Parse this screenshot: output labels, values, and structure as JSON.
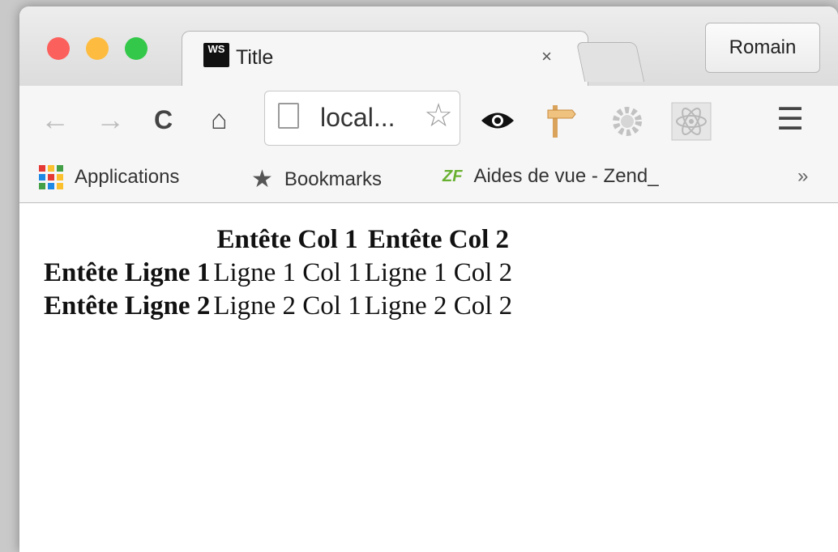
{
  "tab": {
    "favicon_text": "WS",
    "title": "Title",
    "close": "×"
  },
  "profile_button": "Romain",
  "toolbar": {
    "back": "←",
    "forward": "→",
    "reload": "C",
    "home": "⌂",
    "url": "local...",
    "star": "☆",
    "menu": "☰"
  },
  "bookmarks": [
    {
      "label": "Applications",
      "icon": "apps-grid-icon"
    },
    {
      "label": "Bookmarks",
      "icon": "star-icon"
    },
    {
      "label": "Aides de vue - Zend_",
      "icon": "zf-icon",
      "icon_text": "ZF"
    }
  ],
  "bookmarks_overflow": "»",
  "table": {
    "headers": [
      "Entête Col 1",
      "Entête Col 2"
    ],
    "rows": [
      {
        "header": "Entête Ligne 1",
        "cells": [
          "Ligne 1 Col 1",
          "Ligne 1 Col 2"
        ]
      },
      {
        "header": "Entête Ligne 2",
        "cells": [
          "Ligne 2 Col 1",
          "Ligne 2 Col 2"
        ]
      }
    ]
  }
}
